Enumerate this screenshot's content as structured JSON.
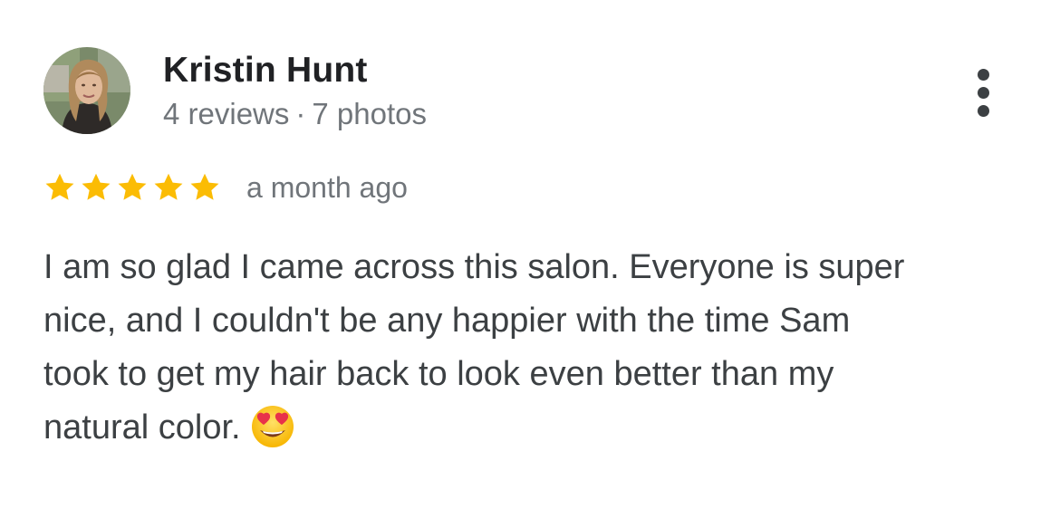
{
  "review": {
    "author": {
      "name": "Kristin Hunt",
      "reviews_count": "4 reviews",
      "separator": "·",
      "photos_count": "7 photos",
      "avatar_icon": "user-photo-avatar"
    },
    "menu_icon": "more-vert-icon",
    "rating": 5,
    "rating_max": 5,
    "time": "a month ago",
    "text_lines": [
      "I am so glad I came across this salon. Everyone is super",
      "nice, and I couldn't be any happier with the time Sam",
      "took to get my hair back to look even better than my",
      "natural color."
    ],
    "emoji": "smiling-face-with-heart-eyes"
  },
  "colors": {
    "star": "#fbbc04",
    "name": "#202124",
    "meta": "#70757a",
    "body": "#3c4043"
  }
}
